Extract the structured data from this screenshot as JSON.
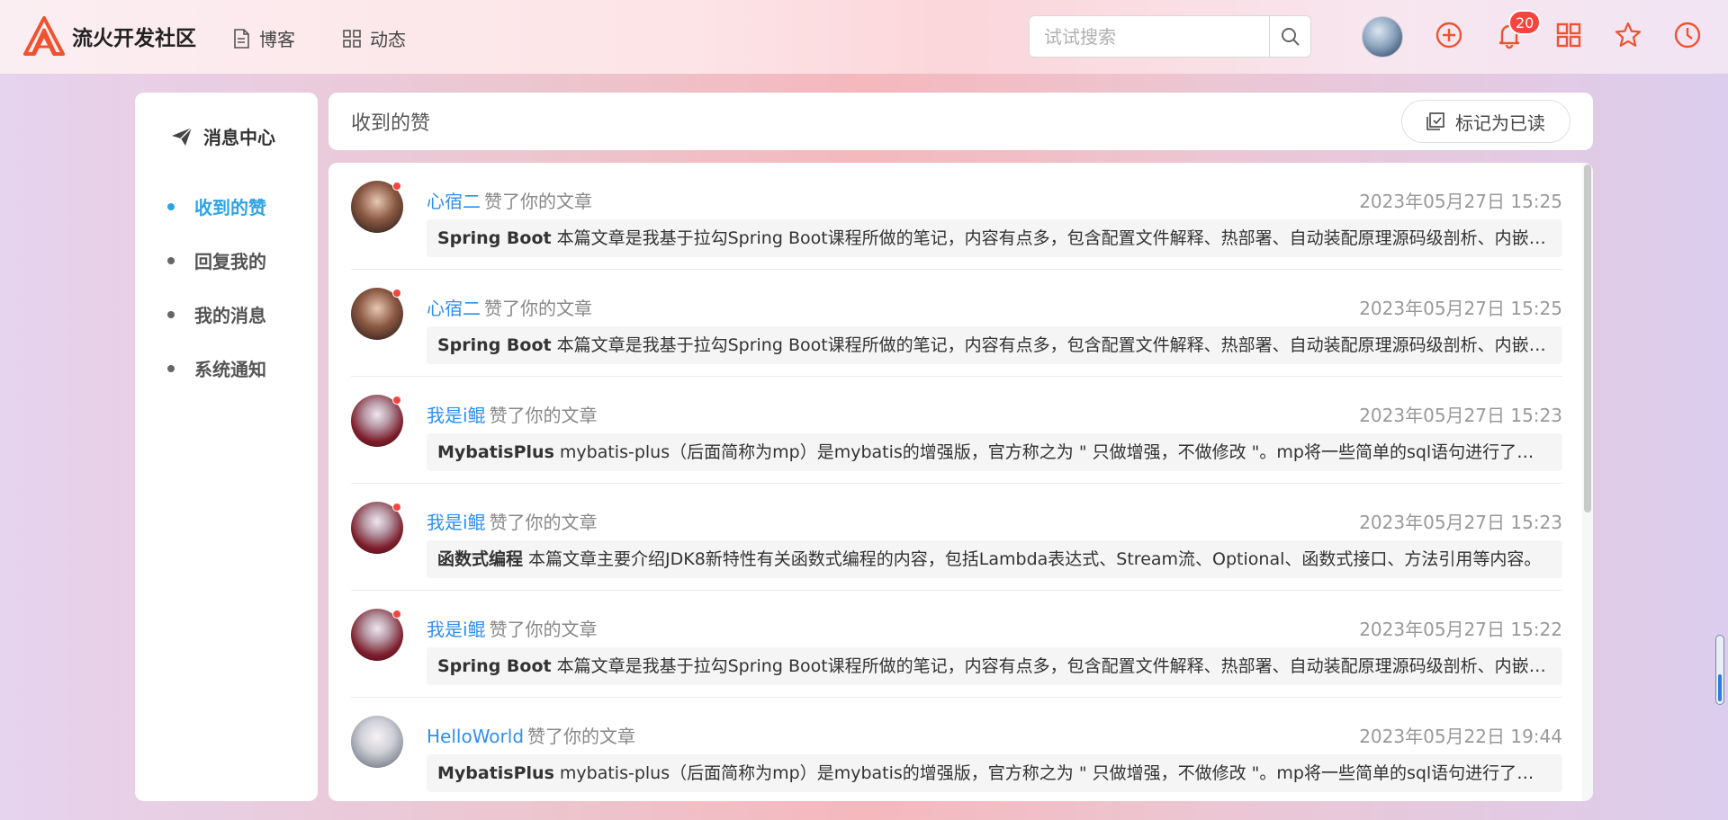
{
  "brand": {
    "name": "流火开发社区",
    "accent": "#f0522f"
  },
  "nav": [
    {
      "label": "博客",
      "icon": "document-icon"
    },
    {
      "label": "动态",
      "icon": "grid-icon"
    }
  ],
  "search": {
    "placeholder": "试试搜索"
  },
  "header_icons": [
    "add-circle-icon",
    "bell-icon",
    "apps-grid-icon",
    "star-icon",
    "clock-icon"
  ],
  "notifications": {
    "count": "20"
  },
  "sidebar": {
    "title": "消息中心",
    "items": [
      {
        "label": "收到的赞",
        "active": true
      },
      {
        "label": "回复我的",
        "active": false
      },
      {
        "label": "我的消息",
        "active": false
      },
      {
        "label": "系统通知",
        "active": false
      }
    ]
  },
  "panel": {
    "title": "收到的赞",
    "mark_read_label": "标记为已读"
  },
  "likes": [
    {
      "user": "心宿二",
      "action": "赞了你的文章",
      "time": "2023年05月27日 15:25",
      "article_title": "Spring Boot",
      "summary": "本篇文章是我基于拉勾Spring Boot课程所做的笔记，内容有点多，包含配置文件解释、热部署、自动装配原理源码级剖析、内嵌t..."
    },
    {
      "user": "心宿二",
      "action": "赞了你的文章",
      "time": "2023年05月27日 15:25",
      "article_title": "Spring Boot",
      "summary": "本篇文章是我基于拉勾Spring Boot课程所做的笔记，内容有点多，包含配置文件解释、热部署、自动装配原理源码级剖析、内嵌t..."
    },
    {
      "user": "我是i鲲",
      "action": "赞了你的文章",
      "time": "2023年05月27日 15:23",
      "article_title": "MybatisPlus",
      "summary": "mybatis-plus（后面简称为mp）是mybatis的增强版，官方称之为 \" 只做增强，不做修改 \"。mp将一些简单的sql语句进行了封装..."
    },
    {
      "user": "我是i鲲",
      "action": "赞了你的文章",
      "time": "2023年05月27日 15:23",
      "article_title": "函数式编程",
      "summary": "本篇文章主要介绍JDK8新特性有关函数式编程的内容，包括Lambda表达式、Stream流、Optional、函数式接口、方法引用等内容。"
    },
    {
      "user": "我是i鲲",
      "action": "赞了你的文章",
      "time": "2023年05月27日 15:22",
      "article_title": "Spring Boot",
      "summary": "本篇文章是我基于拉勾Spring Boot课程所做的笔记，内容有点多，包含配置文件解释、热部署、自动装配原理源码级剖析、内嵌t..."
    },
    {
      "user": "HelloWorld",
      "action": "赞了你的文章",
      "time": "2023年05月22日 19:44",
      "article_title": "MybatisPlus",
      "summary": "mybatis-plus（后面简称为mp）是mybatis的增强版，官方称之为 \" 只做增强，不做修改 \"。mp将一些简单的sql语句进行了封装..."
    }
  ]
}
